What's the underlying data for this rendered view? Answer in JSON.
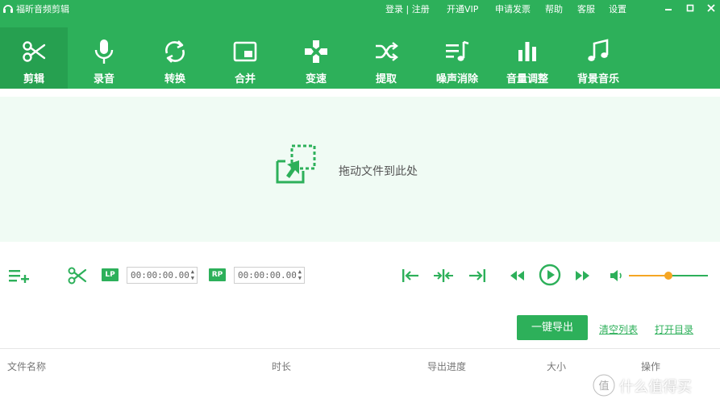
{
  "app": {
    "title": "福昕音频剪辑"
  },
  "colors": {
    "brand_green": "#2db05a",
    "active_tab": "#26a050",
    "drop_bg": "#f0fbf4",
    "accent_orange": "#f5a623"
  },
  "topbar": {
    "login_register": "登录 | 注册",
    "vip": "开通VIP",
    "invoice": "申请发票",
    "help": "帮助",
    "service": "客服",
    "settings": "设置"
  },
  "window_controls": [
    "minimize-icon",
    "maximize-icon",
    "close-icon"
  ],
  "toolbar": {
    "items": [
      {
        "label": "剪辑",
        "icon": "scissors-icon",
        "active": true
      },
      {
        "label": "录音",
        "icon": "microphone-icon",
        "active": false
      },
      {
        "label": "转换",
        "icon": "convert-icon",
        "active": false
      },
      {
        "label": "合并",
        "icon": "merge-icon",
        "active": false
      },
      {
        "label": "变速",
        "icon": "speed-icon",
        "active": false
      },
      {
        "label": "提取",
        "icon": "extract-icon",
        "active": false
      },
      {
        "label": "噪声消除",
        "icon": "noise-reduction-icon",
        "active": false
      },
      {
        "label": "音量调整",
        "icon": "volume-adjust-icon",
        "active": false
      },
      {
        "label": "背景音乐",
        "icon": "music-note-icon",
        "active": false
      }
    ]
  },
  "dropzone": {
    "text": "拖动文件到此处",
    "icon": "drag-file-icon"
  },
  "controls": {
    "lp_label": "LP",
    "rp_label": "RP",
    "lp_time": "00:00:00.00",
    "rp_time": "00:00:00.00",
    "volume_level": 0.5
  },
  "actions": {
    "export_all": "一键导出",
    "clear_list": "清空列表",
    "open_folder": "打开目录"
  },
  "table": {
    "columns": [
      "文件名称",
      "时长",
      "导出进度",
      "大小",
      "操作"
    ]
  },
  "watermark": {
    "text": "什么值得买"
  }
}
